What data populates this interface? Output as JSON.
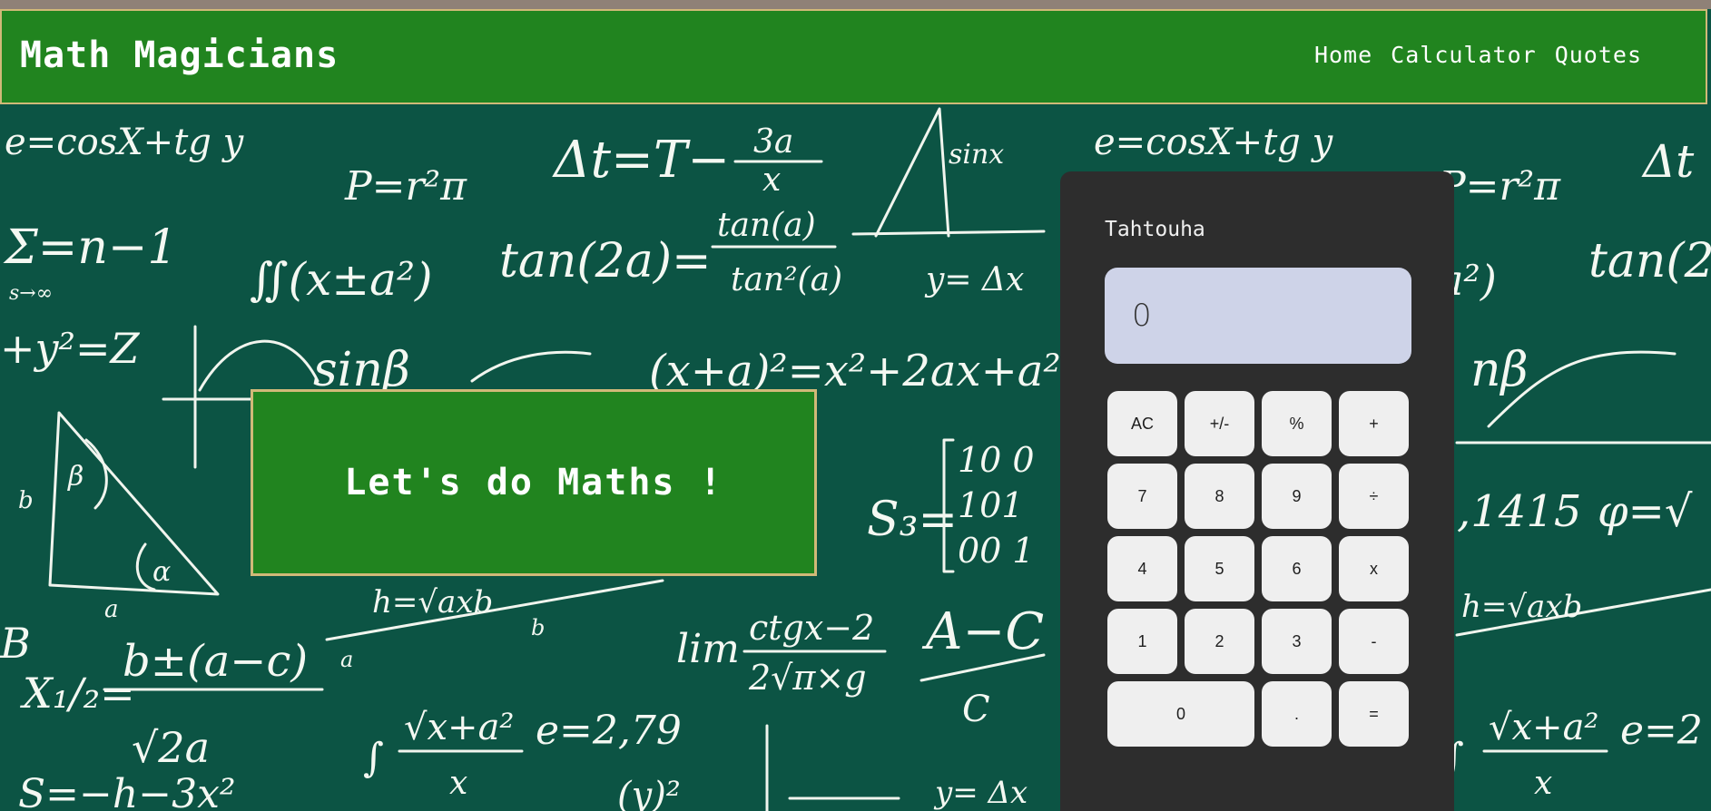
{
  "navbar": {
    "brand": "Math Magicians",
    "links": [
      "Home",
      "Calculator",
      "Quotes"
    ]
  },
  "hero": {
    "title": "Let's do Maths !"
  },
  "calculator": {
    "owner": "Tahtouha",
    "display": "0",
    "keys": [
      "AC",
      "+/-",
      "%",
      "+",
      "7",
      "8",
      "9",
      "÷",
      "4",
      "5",
      "6",
      "x",
      "1",
      "2",
      "3",
      "-",
      "0",
      ".",
      "="
    ]
  },
  "colors": {
    "board": "#0c5444",
    "navbar": "#21841f",
    "border_gold": "#d1b978",
    "calculator_body": "#2d2d2d",
    "display": "#ced3e8",
    "key": "#efefef"
  }
}
